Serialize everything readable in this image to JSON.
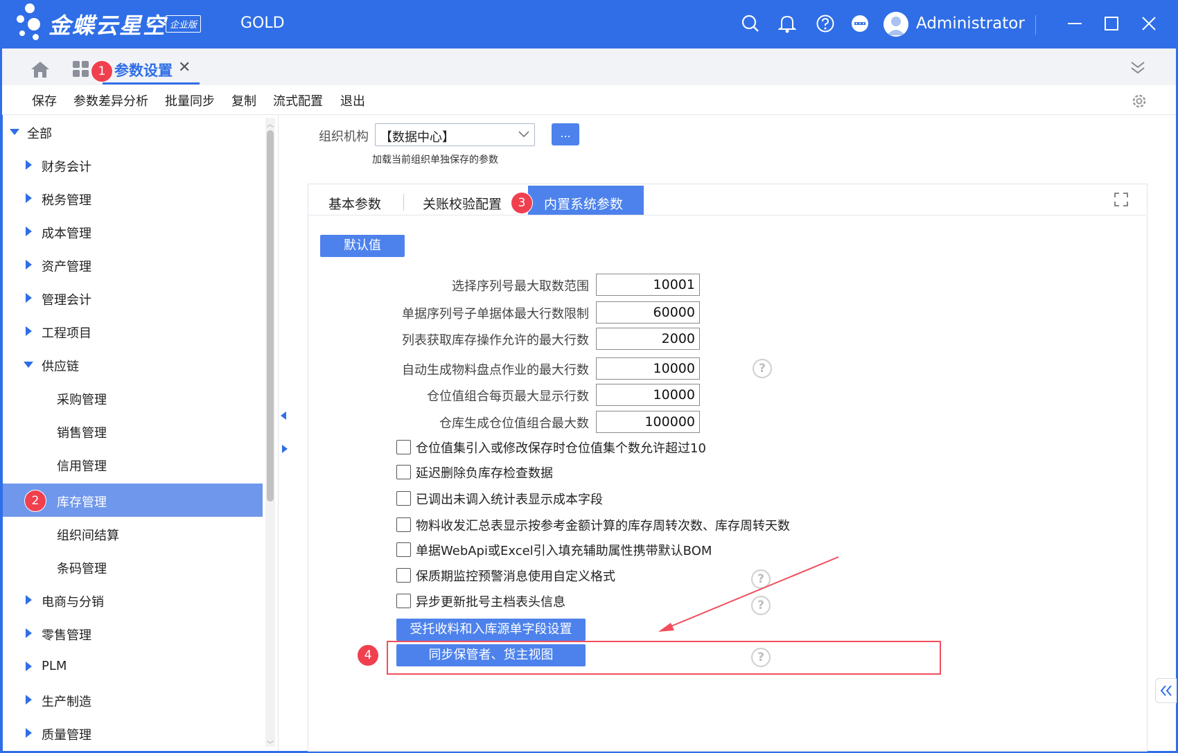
{
  "app": {
    "logo_text": "金蝶云星空",
    "edition_badge": "企业版",
    "database": "GOLD",
    "user_name": "Administrator"
  },
  "tabs": {
    "active_title": "参数设置"
  },
  "toolbar": {
    "items": [
      "保存",
      "参数差异分析",
      "批量同步",
      "复制",
      "流式配置",
      "退出"
    ]
  },
  "sidebar": {
    "root": "全部",
    "items": [
      {
        "label": "财务会计"
      },
      {
        "label": "税务管理"
      },
      {
        "label": "成本管理"
      },
      {
        "label": "资产管理"
      },
      {
        "label": "管理会计"
      },
      {
        "label": "工程项目"
      },
      {
        "label": "供应链"
      },
      {
        "label": "采购管理"
      },
      {
        "label": "销售管理"
      },
      {
        "label": "信用管理"
      },
      {
        "label": "库存管理"
      },
      {
        "label": "组织间结算"
      },
      {
        "label": "条码管理"
      },
      {
        "label": "电商与分销"
      },
      {
        "label": "零售管理"
      },
      {
        "label": "PLM"
      },
      {
        "label": "生产制造"
      },
      {
        "label": "质量管理"
      }
    ]
  },
  "org": {
    "label": "组织机构",
    "value": "【数据中心】",
    "more_label": "...",
    "hint": "加载当前组织单独保存的参数"
  },
  "panel_tabs": [
    "基本参数",
    "关账校验配置",
    "内置系统参数"
  ],
  "default_button": "默认值",
  "numeric_fields": [
    {
      "label": "选择序列号最大取数范围",
      "value": "10001"
    },
    {
      "label": "单据序列号子单据体最大行数限制",
      "value": "60000"
    },
    {
      "label": "列表获取库存操作允许的最大行数",
      "value": "2000"
    },
    {
      "label": "自动生成物料盘点作业的最大行数",
      "value": "10000"
    },
    {
      "label": "仓位值组合每页最大显示行数",
      "value": "10000"
    },
    {
      "label": "仓库生成仓位值组合最大数",
      "value": "100000"
    }
  ],
  "checkboxes": [
    {
      "label": "仓位值集引入或修改保存时仓位值集个数允许超过10"
    },
    {
      "label": "延迟删除负库存检查数据"
    },
    {
      "label": "已调出未调入统计表显示成本字段"
    },
    {
      "label": "物料收发汇总表显示按参考金额计算的库存周转次数、库存周转天数"
    },
    {
      "label": "单据WebApi或Excel引入填充辅助属性携带默认BOM"
    },
    {
      "label": "保质期监控预警消息使用自定义格式"
    },
    {
      "label": "异步更新批号主档表头信息"
    }
  ],
  "action_buttons": [
    "受托收料和入库源单字段设置",
    "同步保管者、货主视图"
  ],
  "badges": [
    "1",
    "2",
    "3",
    "4"
  ],
  "help_glyph": "?",
  "colors": {
    "brand": "#2f6ee6",
    "accent": "#4d82ec",
    "badge": "#f0404f"
  }
}
